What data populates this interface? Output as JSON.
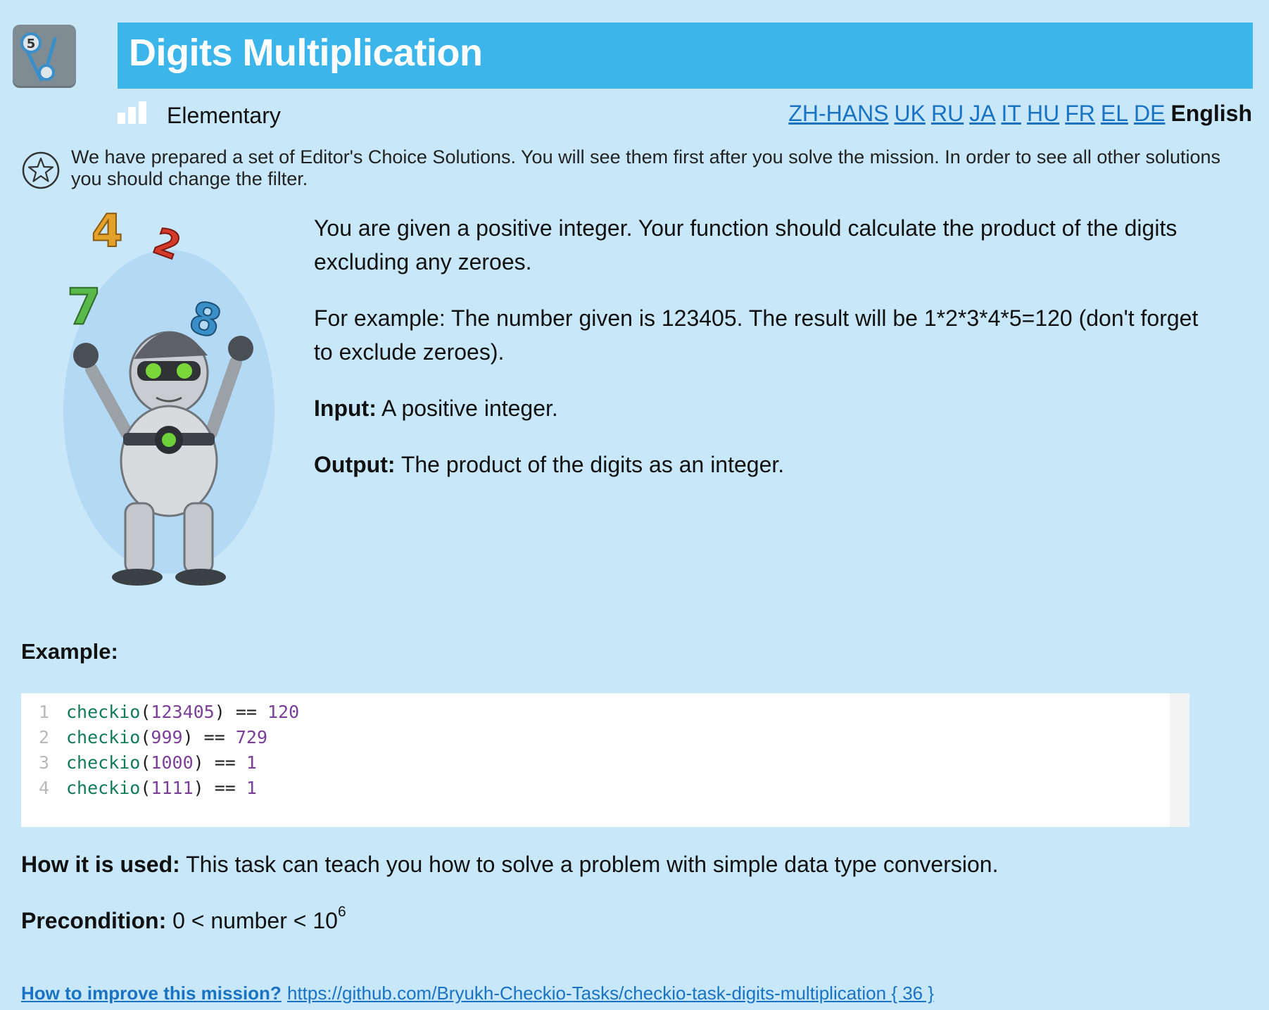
{
  "header": {
    "title": "Digits Multiplication",
    "level": "Elementary",
    "languages": [
      "ZH-HANS",
      "UK",
      "RU",
      "JA",
      "IT",
      "HU",
      "FR",
      "EL",
      "DE"
    ],
    "current_language": "English"
  },
  "notice": "We have prepared a set of Editor's Choice Solutions. You will see them first after you solve the mission. In order to see all other solutions you should change the filter.",
  "description": {
    "p1": "You are given a positive integer. Your function should calculate the product of the digits excluding any zeroes.",
    "p2": "For example: The number given is 123405. The result will be 1*2*3*4*5=120 (don't forget to exclude zeroes).",
    "input_label": "Input:",
    "input_text": " A positive integer.",
    "output_label": "Output:",
    "output_text": " The product of the digits as an integer."
  },
  "example_heading": "Example:",
  "code_lines": [
    {
      "n": "1",
      "fn": "checkio",
      "arg": "123405",
      "op": ") == ",
      "res": "120"
    },
    {
      "n": "2",
      "fn": "checkio",
      "arg": "999",
      "op": ") == ",
      "res": "729"
    },
    {
      "n": "3",
      "fn": "checkio",
      "arg": "1000",
      "op": ") == ",
      "res": "1"
    },
    {
      "n": "4",
      "fn": "checkio",
      "arg": "1111",
      "op": ") == ",
      "res": "1"
    }
  ],
  "how_used": {
    "label": "How it is used:",
    "text": " This task can teach you how to solve a problem with simple data type conversion."
  },
  "precondition": {
    "label": "Precondition:",
    "text": " 0 < number < 10",
    "exponent": "6"
  },
  "footer": {
    "improve_link": "How to improve this mission?",
    "github_link": "https://github.com/Bryukh-Checkio-Tasks/checkio-task-digits-multiplication { 36 }"
  },
  "colors": {
    "background": "#c8e8f9",
    "title_bar": "#3bb5ea",
    "link": "#1a73c2"
  }
}
